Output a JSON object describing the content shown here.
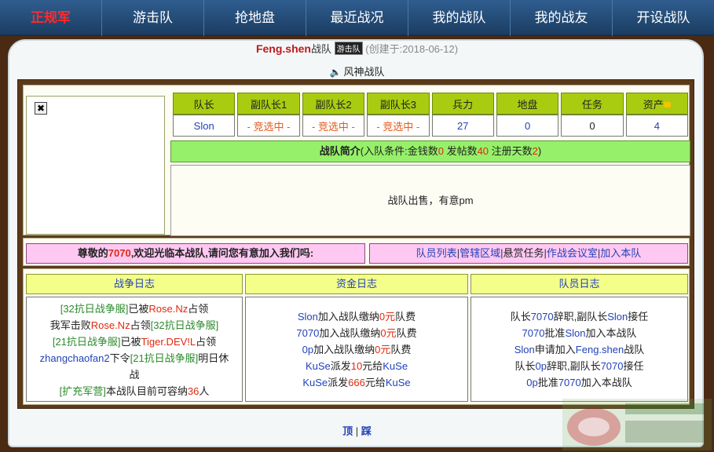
{
  "nav": {
    "items": [
      {
        "label": "正规军",
        "active": true
      },
      {
        "label": "游击队"
      },
      {
        "label": "抢地盘"
      },
      {
        "label": "最近战况"
      },
      {
        "label": "我的战队"
      },
      {
        "label": "我的战友"
      },
      {
        "label": "开设战队"
      }
    ]
  },
  "header": {
    "leader": "Feng.shen",
    "suffix": "战队",
    "tag": "游击队",
    "created": "(创建于:2018-06-12)",
    "team_name": "风神战队"
  },
  "stats": {
    "headers": [
      "队长",
      "副队长1",
      "副队长2",
      "副队长3",
      "兵力",
      "地盘",
      "任务",
      "资产"
    ],
    "values": [
      "Slon",
      "- 竞选中 -",
      "- 竞选中 -",
      "- 竞选中 -",
      "27",
      "0",
      "0",
      "4"
    ]
  },
  "intro": {
    "title": "战队简介",
    "cond_prefix": "(入队条件:金钱数",
    "money": "0",
    "posts_label": " 发帖数",
    "posts": "40",
    "days_label": " 注册天数",
    "days": "2",
    "cond_suffix": ")",
    "body": "战队出售，有意pm"
  },
  "welcome": {
    "prefix": "尊敬的",
    "user": "7070",
    "suffix": ",欢迎光临本战队,请问您有意加入我们吗:"
  },
  "links": [
    "队员列表",
    "管辖区域",
    "悬赏任务",
    "作战会议室",
    "加入本队"
  ],
  "logs": {
    "war_title": "战争日志",
    "fund_title": "资金日志",
    "member_title": "队员日志",
    "war": [
      {
        "a": "[32抗日战争服]",
        "b": "已被",
        "c": "Rose.Nz",
        "d": "占领"
      },
      {
        "a": "我军击败",
        "b": "Rose.Nz",
        "c": "占领",
        "d": "[32抗日战争服]"
      },
      {
        "a": "[21抗日战争服]",
        "b": "已被",
        "c": "Tiger.DEV!L",
        "d": "占领"
      },
      {
        "a": "zhangchaofan2",
        "b": "下令",
        "c": "[21抗日战争服]",
        "d": "明日休"
      },
      {
        "a": "战"
      },
      {
        "a": "[扩充军营]",
        "b": "本战队目前可容纳",
        "c": "36",
        "d": "人"
      }
    ],
    "fund": [
      {
        "a": "Slon",
        "b": "加入战队缴纳",
        "c": "0元",
        "d": "队费"
      },
      {
        "a": "7070",
        "b": "加入战队缴纳",
        "c": "0元",
        "d": "队费"
      },
      {
        "a": "0p",
        "b": "加入战队缴纳",
        "c": "0元",
        "d": "队费"
      },
      {
        "a": "KuSe",
        "b": "派发",
        "c": "10",
        "d": "元给",
        "e": "KuSe"
      },
      {
        "a": "KuSe",
        "b": "派发",
        "c": "666",
        "d": "元给",
        "e": "KuSe"
      }
    ],
    "member": [
      {
        "a": "队长",
        "b": "7070",
        "c": "辞职,副队长",
        "d": "Slon",
        "e": "接任"
      },
      {
        "a": "7070",
        "b": "批准",
        "c": "Slon",
        "d": "加入本战队"
      },
      {
        "a": "Slon",
        "b": "申请加入",
        "c": "Feng.shen",
        "d": "战队"
      },
      {
        "a": "队长",
        "b": "0p",
        "c": "辞职,副队长",
        "d": "7070",
        "e": "接任"
      },
      {
        "a": "0p",
        "b": "批准",
        "c": "7070",
        "d": "加入本战队"
      }
    ]
  },
  "footer": {
    "top": "顶",
    "bottom": "踩"
  },
  "colors": {
    "nav_bg": "#234a74",
    "stat_header": "#a9cc10",
    "intro_bar": "#96f06a",
    "pink": "#ffc8f2",
    "log_head": "#f4ff8a",
    "frame": "#5b3a1a"
  }
}
